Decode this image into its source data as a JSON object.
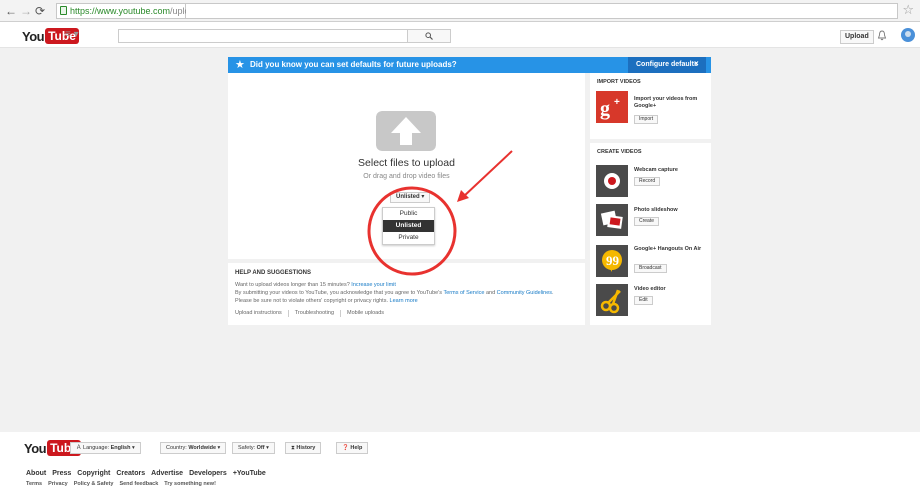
{
  "browser": {
    "url_host": "https://www.youtube.com",
    "url_path": "/upload",
    "back_icon": "left-arrow-icon",
    "forward_icon": "right-arrow-icon",
    "reload_icon": "reload-icon"
  },
  "header": {
    "logo_you": "You",
    "logo_tube": "Tube",
    "guide_label": "≡ ▾",
    "upload_label": "Upload"
  },
  "banner": {
    "text": "Did you know you can set defaults for future uploads?",
    "configure_label": "Configure defaults",
    "close_label": "×"
  },
  "upload": {
    "title": "Select files to upload",
    "subtitle": "Or drag and drop video files",
    "privacy_selected": "Unlisted ▾",
    "privacy_options": [
      "Public",
      "Unlisted",
      "Private"
    ]
  },
  "help": {
    "title": "HELP AND SUGGESTIONS",
    "line1_text": "Want to upload videos longer than 15 minutes? ",
    "line1_link": "Increase your limit",
    "line2_text": "By submitting your videos to YouTube, you acknowledge that you agree to YouTube's ",
    "line2_link1": "Terms of Service",
    "line2_mid": " and ",
    "line2_link2": "Community Guidelines",
    "line2_end": ".",
    "line3_text": "Please be sure not to violate others' copyright or privacy rights. ",
    "line3_link": "Learn more",
    "links": [
      "Upload instructions",
      "Troubleshooting",
      "Mobile uploads"
    ]
  },
  "import": {
    "title": "IMPORT VIDEOS",
    "item_title": "Import your videos from Google+",
    "item_button": "Import"
  },
  "create": {
    "title": "CREATE VIDEOS",
    "items": [
      {
        "title": "Webcam capture",
        "button": "Record"
      },
      {
        "title": "Photo slideshow",
        "button": "Create"
      },
      {
        "title": "Google+ Hangouts On Air",
        "button": "Broadcast"
      },
      {
        "title": "Video editor",
        "button": "Edit"
      }
    ]
  },
  "footer": {
    "logo_you": "You",
    "logo_tube": "Tube",
    "language_prefix": "Language: ",
    "language_value": "English ▾",
    "country_prefix": "Country: ",
    "country_value": "Worldwide ▾",
    "safety_prefix": "Safety: ",
    "safety_value": "Off ▾",
    "history_label": "History",
    "help_label": "Help",
    "links": [
      "About",
      "Press",
      "Copyright",
      "Creators",
      "Advertise",
      "Developers",
      "+YouTube"
    ],
    "sublinks": [
      "Terms",
      "Privacy",
      "Policy & Safety",
      "Send feedback",
      "Try something new!"
    ]
  },
  "colors": {
    "banner": "#2793e6",
    "yt_red": "#cc181e",
    "annotation_red": "#e8322f",
    "link": "#167ac6"
  }
}
